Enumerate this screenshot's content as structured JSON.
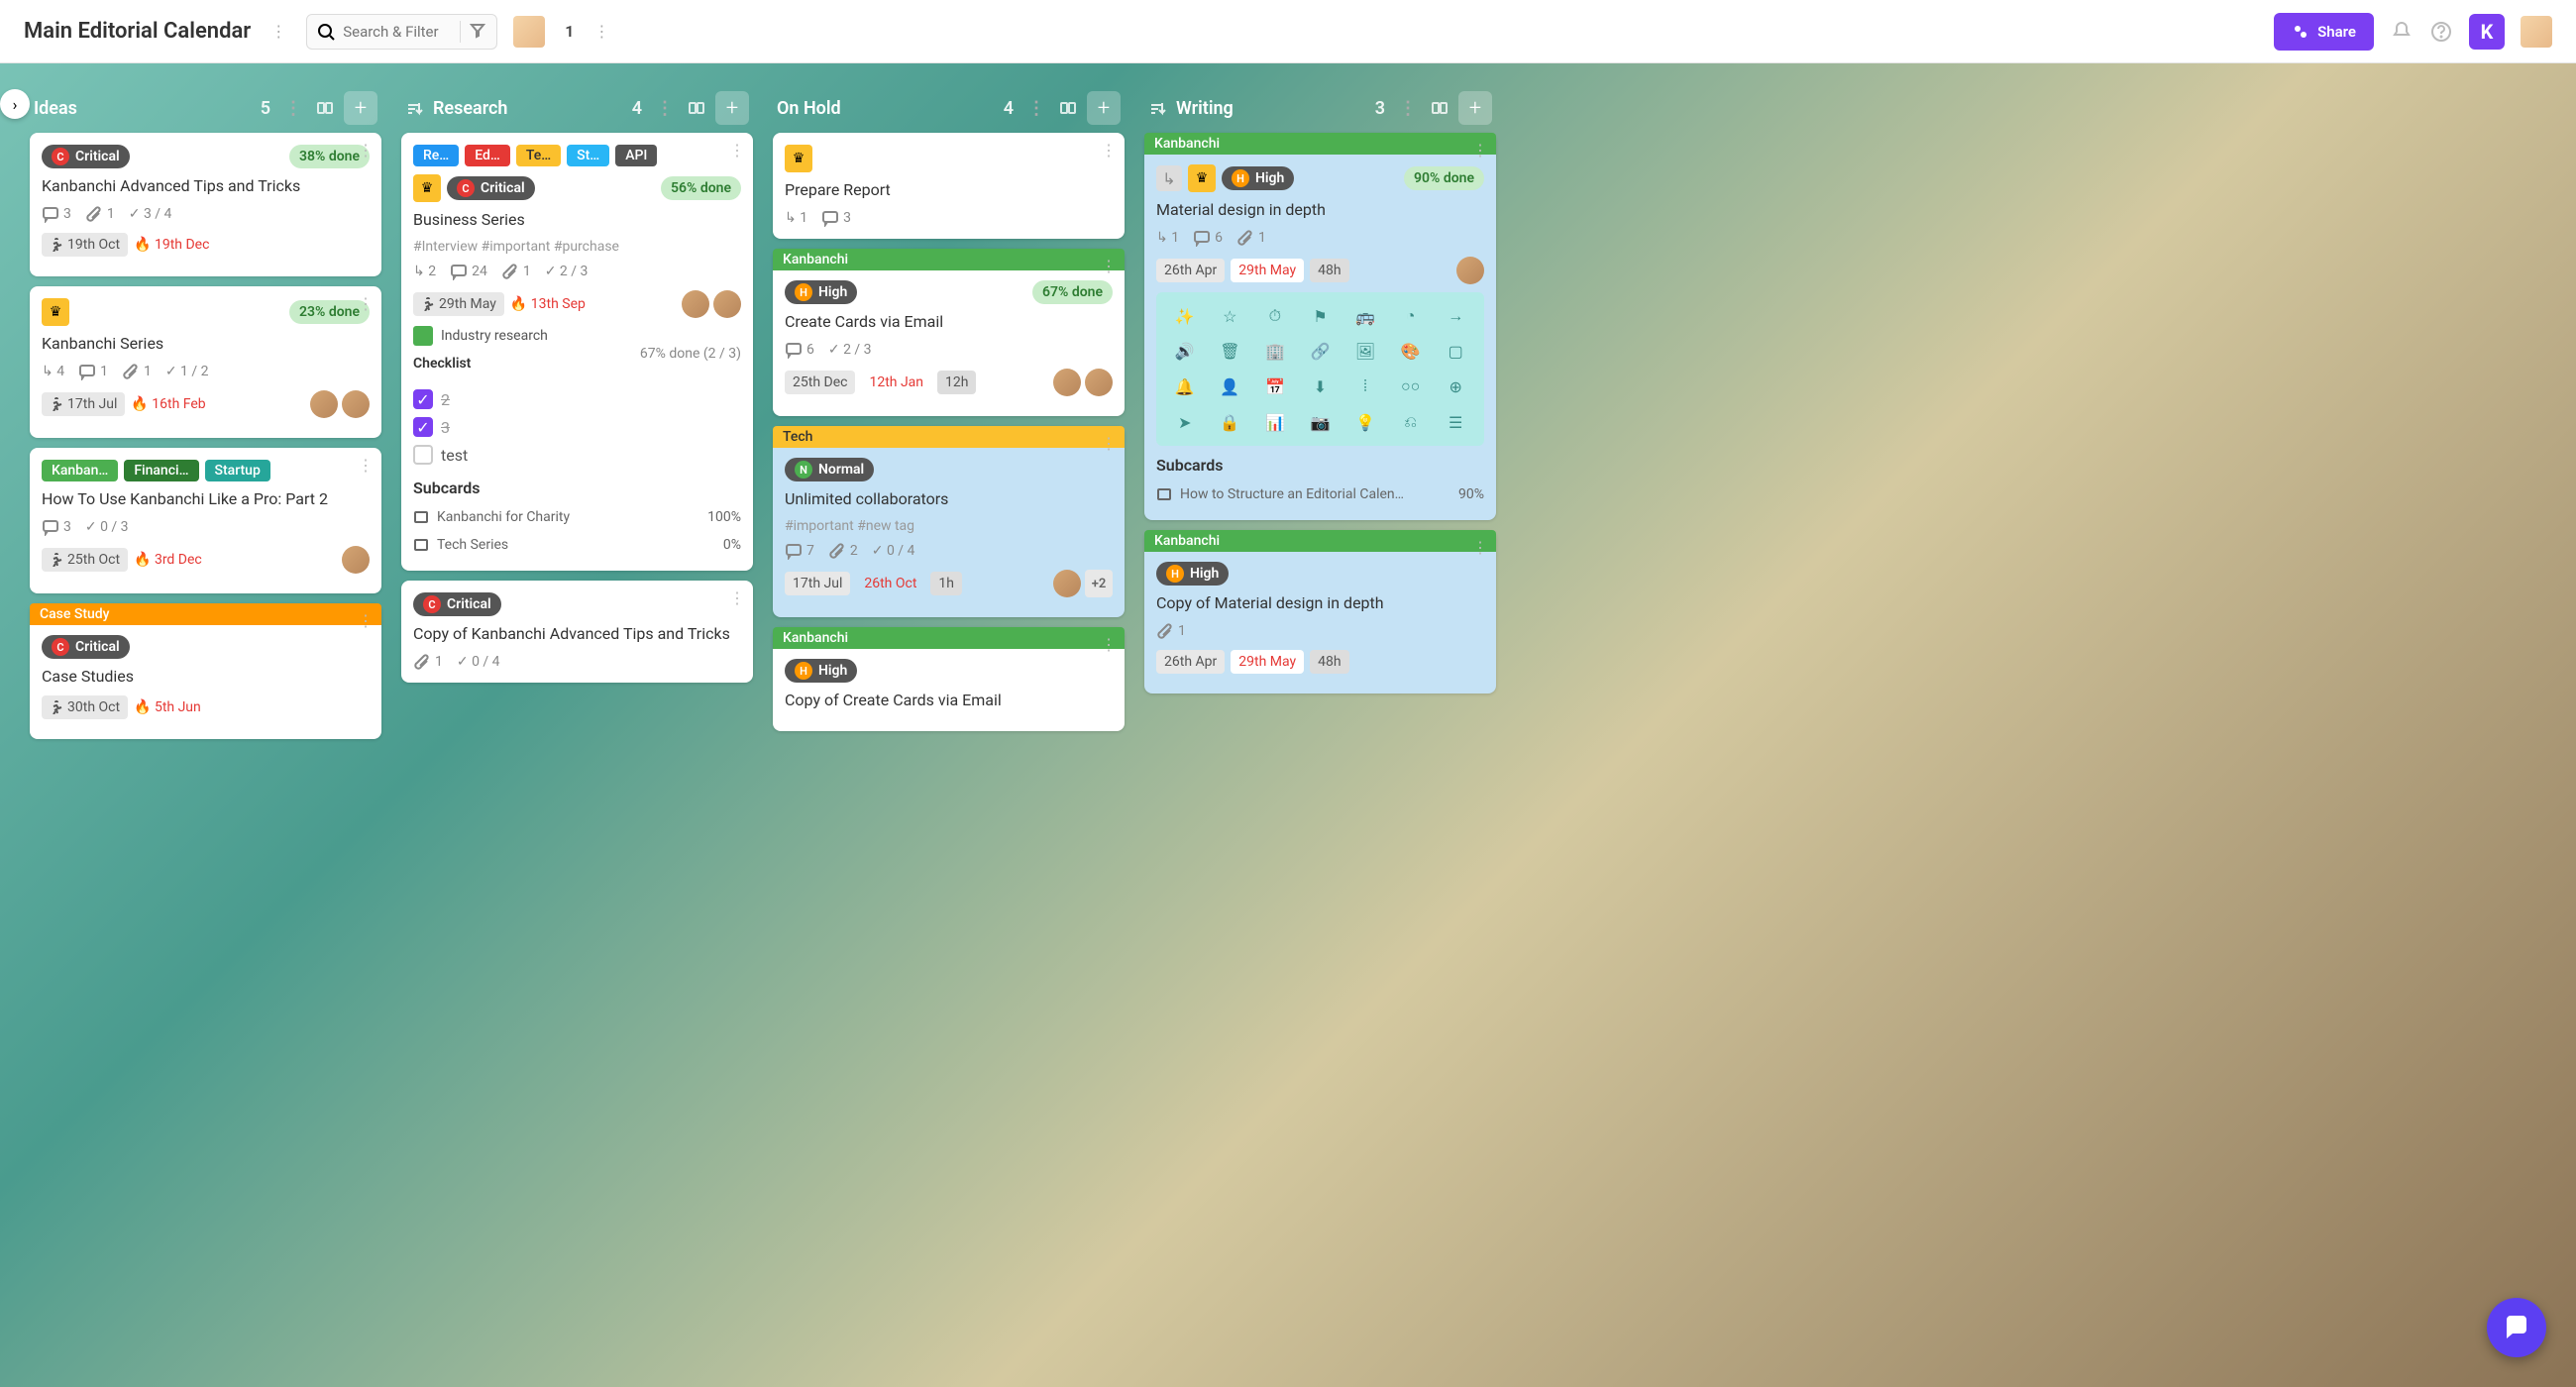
{
  "header": {
    "title": "Main Editorial Calendar",
    "search_placeholder": "Search & Filter",
    "member_count": "1",
    "share": "Share"
  },
  "columns": [
    {
      "title": "Ideas",
      "count": "5",
      "sort": false,
      "cards": [
        {
          "priority": "Critical",
          "done": "38% done",
          "title": "Kanbanchi Advanced Tips and Tricks",
          "comments": "3",
          "attachments": "1",
          "check": "3 / 4",
          "date1": "19th Oct",
          "date2": "19th Dec"
        },
        {
          "crown": true,
          "done": "23% done",
          "title": "Kanbanchi Series",
          "sub": "4",
          "comments": "1",
          "attachments": "1",
          "check": "1 / 2",
          "date1": "17th Jul",
          "date2": "16th Feb",
          "avatars": 2
        },
        {
          "tags": [
            {
              "t": "Kanban…",
              "c": "green"
            },
            {
              "t": "Financi…",
              "c": "dark-green"
            },
            {
              "t": "Startup",
              "c": "teal"
            }
          ],
          "title": "How To Use Kanbanchi Like a Pro: Part 2",
          "comments": "3",
          "check": "0 / 3",
          "date1": "25th Oct",
          "date2": "3rd Dec",
          "avatars": 1
        },
        {
          "strip": {
            "t": "Case Study",
            "c": "orange"
          },
          "priority": "Critical",
          "title": "Case Studies",
          "date1": "30th Oct",
          "date2": "5th Jun"
        }
      ]
    },
    {
      "title": "Research",
      "count": "4",
      "sort": true,
      "cards": [
        {
          "tags": [
            {
              "t": "Re…",
              "c": "blue"
            },
            {
              "t": "Ed…",
              "c": "red"
            },
            {
              "t": "Te…",
              "c": "yellow"
            },
            {
              "t": "St…",
              "c": "cyan"
            },
            {
              "t": "API",
              "c": "grey"
            }
          ],
          "crown": true,
          "priority": "Critical",
          "done": "56% done",
          "title": "Business Series",
          "hashtags": "#Interview #important #purchase",
          "sub": "2",
          "comments": "24",
          "attachments": "1",
          "check": "2 / 3",
          "date1": "29th May",
          "date2": "13th Sep",
          "avatars": 2,
          "doc": "Industry research",
          "checklist_title": "Checklist",
          "checklist_progress": "67% done (2 / 3)",
          "checklist": [
            {
              "text": "2",
              "done": true
            },
            {
              "text": "3",
              "done": true
            },
            {
              "text": "test",
              "done": false
            }
          ],
          "subcards_title": "Subcards",
          "subcards": [
            {
              "name": "Kanbanchi for Charity",
              "pct": "100%"
            },
            {
              "name": "Tech Series",
              "pct": "0%"
            }
          ]
        },
        {
          "priority": "Critical",
          "title": "Copy of Kanbanchi Advanced Tips and Tricks",
          "attachments": "1",
          "check": "0 / 4"
        }
      ]
    },
    {
      "title": "On Hold",
      "count": "4",
      "sort": false,
      "cards": [
        {
          "crown": true,
          "title": "Prepare Report",
          "sub": "1",
          "comments": "3"
        },
        {
          "strip": {
            "t": "Kanbanchi",
            "c": "green"
          },
          "priority_high": "High",
          "done": "67% done",
          "title": "Create Cards via Email",
          "comments": "6",
          "check": "2 / 3",
          "date1_plain": "25th Dec",
          "date2_red": "12th Jan",
          "hours": "12h",
          "avatars": 2
        },
        {
          "blue": true,
          "strip": {
            "t": "Tech",
            "c": "yellow"
          },
          "priority_normal": "Normal",
          "title": "Unlimited collaborators",
          "hashtags": "#important #new tag",
          "comments": "7",
          "attachments": "2",
          "check": "0 / 4",
          "date1_plain": "17th Jul",
          "date2_red": "26th Oct",
          "hours": "1h",
          "avatars": 1,
          "avatar_extra": "+2"
        },
        {
          "strip": {
            "t": "Kanbanchi",
            "c": "green"
          },
          "priority_high": "High",
          "title": "Copy of Create Cards via Email"
        }
      ]
    },
    {
      "title": "Writing",
      "count": "3",
      "sort": true,
      "cards": [
        {
          "blue": true,
          "strip": {
            "t": "Kanbanchi",
            "c": "green"
          },
          "crown": true,
          "priority_high": "High",
          "done": "90% done",
          "title": "Material design in depth",
          "sub": "1",
          "comments": "6",
          "attachments": "1",
          "date1_plain": "26th Apr",
          "date2_box": "29th May",
          "hours": "48h",
          "avatars": 1,
          "icon_grid": true,
          "subcards_title": "Subcards",
          "subcards": [
            {
              "name": "How to Structure an Editorial Calen…",
              "pct": "90%"
            }
          ]
        },
        {
          "blue": true,
          "strip": {
            "t": "Kanbanchi",
            "c": "green"
          },
          "priority_high": "High",
          "title": "Copy of Material design in depth",
          "attachments": "1",
          "date1_plain": "26th Apr",
          "date2_box": "29th May",
          "hours": "48h"
        }
      ]
    }
  ]
}
